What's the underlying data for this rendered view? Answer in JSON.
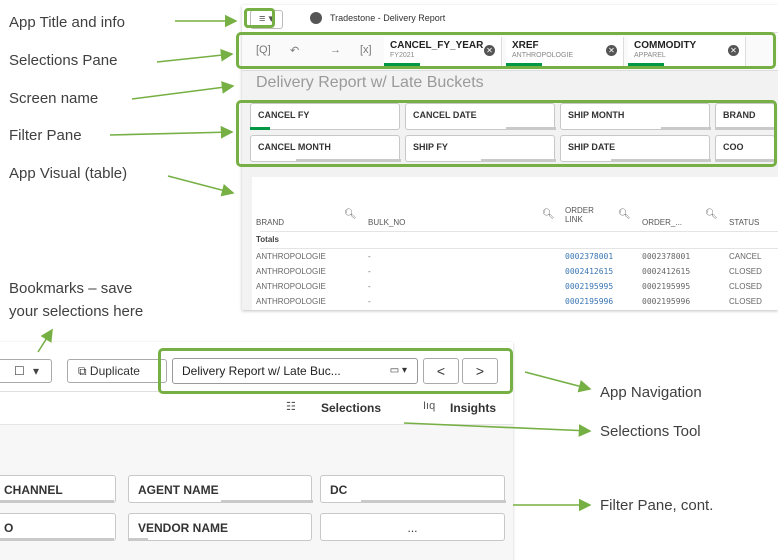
{
  "labels": {
    "app_title_info": "App Title and info",
    "selections_pane": "Selections Pane",
    "screen_name": "Screen name",
    "filter_pane": "Filter Pane",
    "app_visual": "App Visual (table)",
    "bookmarks": "Bookmarks – save",
    "bookmarks_2": "your selections here",
    "app_navigation": "App Navigation",
    "selections_tool": "Selections Tool",
    "filter_pane_cont": "Filter Pane, cont."
  },
  "top": {
    "menu_icon": "≡ ▾",
    "app_title": "Tradestone - Delivery Report",
    "screen_name": "Delivery Report w/ Late Buckets",
    "selections": [
      {
        "field": "CANCEL_FY_YEAR",
        "value": "FY2021"
      },
      {
        "field": "XREF",
        "value": "ANTHROPOLOGIE"
      },
      {
        "field": "COMMODITY",
        "value": "APPAREL"
      }
    ],
    "filters_row1": [
      "CANCEL FY",
      "CANCEL DATE",
      "SHIP MONTH",
      "BRAND"
    ],
    "filters_row2": [
      "CANCEL MONTH",
      "SHIP FY",
      "SHIP DATE",
      "COO"
    ],
    "table": {
      "headers": [
        "BRAND",
        "BULK_NO",
        "ORDER LINK",
        "ORDER_...",
        "STATUS"
      ],
      "totals_label": "Totals",
      "rows": [
        [
          "ANTHROPOLOGIE",
          "-",
          "0002378001",
          "0002378001",
          "CANCEL"
        ],
        [
          "ANTHROPOLOGIE",
          "-",
          "0002412615",
          "0002412615",
          "CLOSED"
        ],
        [
          "ANTHROPOLOGIE",
          "-",
          "0002195995",
          "0002195995",
          "CLOSED"
        ],
        [
          "ANTHROPOLOGIE",
          "-",
          "0002195996",
          "0002195996",
          "CLOSED"
        ]
      ]
    }
  },
  "bottom": {
    "bookmark_btn": "▾",
    "duplicate_btn": "Duplicate",
    "sheet_name": "Delivery Report w/ Late Buc...",
    "prev": "<",
    "next": ">",
    "selections": "Selections",
    "insights": "Insights",
    "filters_row1": [
      "CHANNEL",
      "AGENT NAME",
      "DC"
    ],
    "filters_row2": [
      "O",
      "VENDOR NAME",
      "..."
    ]
  },
  "colors": {
    "highlight": "#76b044",
    "accent": "#009845",
    "link": "#3a76b5"
  }
}
